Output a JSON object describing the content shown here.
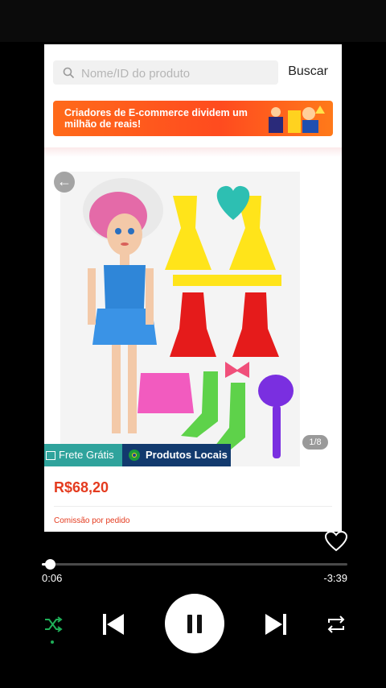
{
  "search": {
    "placeholder": "Nome/ID do produto",
    "button_label": "Buscar"
  },
  "banner": {
    "text": "Criadores de E-commerce dividem um milhão de reais!"
  },
  "product": {
    "image_counter": "1/8",
    "badge_free_shipping": "Frete Grátis",
    "badge_local": "Produtos Locais",
    "price": "R$68,20",
    "commission_label": "Comissão por pedido"
  },
  "player": {
    "elapsed": "0:06",
    "remaining": "-3:39",
    "progress": 0.027,
    "accent_color": "#1fae58"
  },
  "icons": [
    "search-icon",
    "back-arrow-icon",
    "heart-icon",
    "shuffle-icon",
    "previous-icon",
    "pause-icon",
    "next-icon",
    "repeat-icon"
  ]
}
